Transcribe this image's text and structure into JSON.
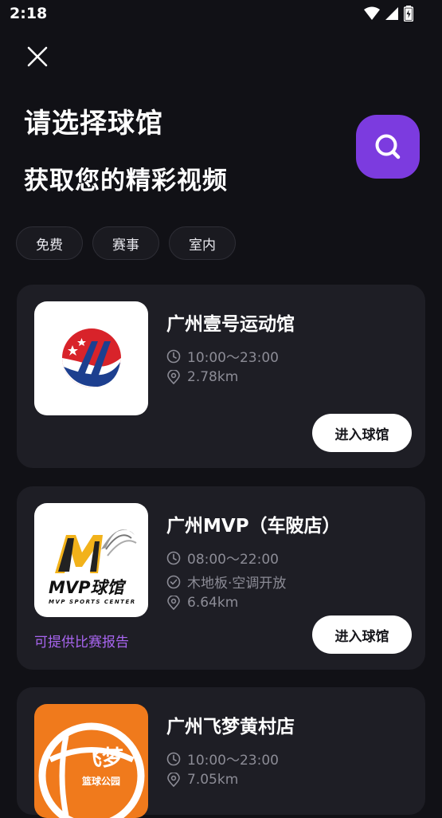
{
  "status_bar": {
    "time": "2:18"
  },
  "header": {
    "title": "请选择球馆",
    "subtitle": "获取您的精彩视频"
  },
  "filters": [
    {
      "label": "免费"
    },
    {
      "label": "赛事"
    },
    {
      "label": "室内"
    }
  ],
  "venues": [
    {
      "name": "广州壹号运动馆",
      "hours": "10:00～23:00",
      "distance": "2.78km",
      "enter_label": "进入球馆"
    },
    {
      "name": "广州MVP（车陂店）",
      "hours": "08:00～22:00",
      "features": "木地板·空调开放",
      "distance": "6.64km",
      "report_label": "可提供比赛报告",
      "enter_label": "进入球馆",
      "logo_text": "MVP球馆",
      "logo_subtext": "MVP SPORTS CENTER"
    },
    {
      "name": "广州飞梦黄村店",
      "hours": "10:00～23:00",
      "distance": "7.05km",
      "logo_text": "飞梦",
      "logo_subtext": "篮球公园"
    }
  ],
  "colors": {
    "background": "#111116",
    "card": "#1e1e25",
    "accent": "#7c3bdf",
    "report_text": "#a865f0"
  }
}
